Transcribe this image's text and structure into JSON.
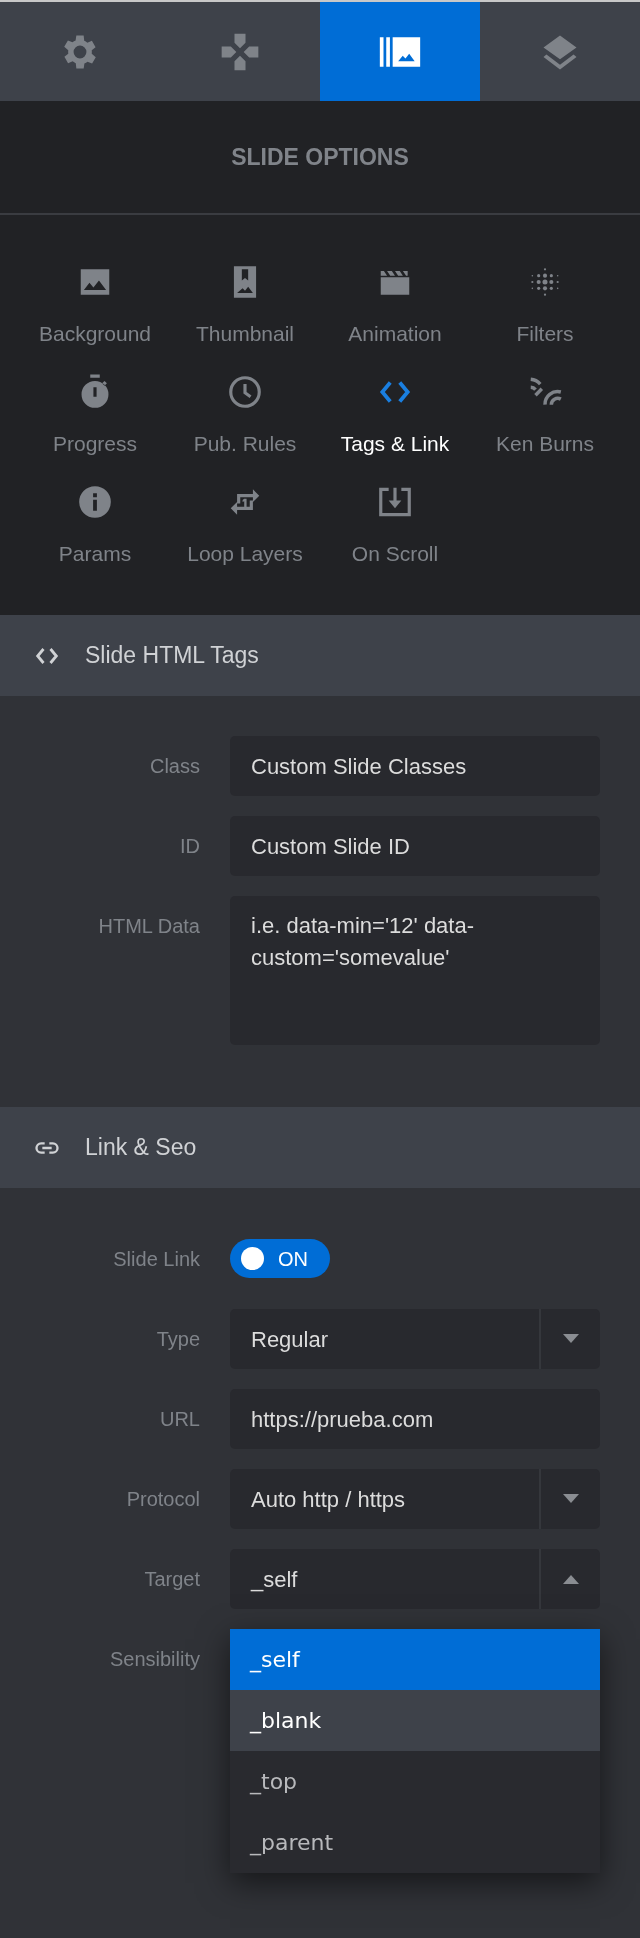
{
  "tabs": [
    {
      "kind": "gear",
      "selected": false
    },
    {
      "kind": "dpad",
      "selected": false
    },
    {
      "kind": "slides",
      "selected": true
    },
    {
      "kind": "layers",
      "selected": false
    }
  ],
  "panel_title": "SLIDE OPTIONS",
  "option_items": [
    {
      "label": "Background",
      "kind": "image",
      "selected": false
    },
    {
      "label": "Thumbnail",
      "kind": "bookmark",
      "selected": false
    },
    {
      "label": "Animation",
      "kind": "clapper",
      "selected": false
    },
    {
      "label": "Filters",
      "kind": "dots",
      "selected": false
    },
    {
      "label": "Progress",
      "kind": "timer",
      "selected": false
    },
    {
      "label": "Pub. Rules",
      "kind": "clock",
      "selected": false
    },
    {
      "label": "Tags & Link",
      "kind": "code",
      "selected": true
    },
    {
      "label": "Ken Burns",
      "kind": "waves",
      "selected": false
    },
    {
      "label": "Params",
      "kind": "info",
      "selected": false
    },
    {
      "label": "Loop Layers",
      "kind": "repeat",
      "selected": false
    },
    {
      "label": "On Scroll",
      "kind": "download",
      "selected": false
    }
  ],
  "sections": [
    {
      "title": "Slide HTML Tags",
      "kind": "code",
      "fields": [
        {
          "label": "Class",
          "kind": "text",
          "value": "Custom Slide Classes"
        },
        {
          "label": "ID",
          "kind": "text",
          "value": "Custom Slide ID"
        },
        {
          "label": "HTML Data",
          "kind": "textarea",
          "value": "i.e. data-min='12' data-custom='somevalue'"
        }
      ]
    },
    {
      "title": "Link & Seo",
      "kind": "link",
      "fields": [
        {
          "label": "Slide Link",
          "kind": "toggle",
          "on": true,
          "text": "ON"
        },
        {
          "label": "Type",
          "kind": "select",
          "value": "Regular",
          "expanded": false
        },
        {
          "label": "URL",
          "kind": "text",
          "value": "https://prueba.com"
        },
        {
          "label": "Protocol",
          "kind": "select",
          "value": "Auto http / https",
          "expanded": false
        },
        {
          "label": "Target",
          "kind": "select",
          "value": "_self",
          "expanded": true,
          "options": [
            {
              "label": "_self",
              "selected": true,
              "highlighted": false
            },
            {
              "label": "_blank",
              "selected": false,
              "highlighted": true
            },
            {
              "label": "_top",
              "selected": false,
              "highlighted": false
            },
            {
              "label": "_parent",
              "selected": false,
              "highlighted": false
            }
          ]
        },
        {
          "label": "Sensibility",
          "kind": "hidden"
        }
      ]
    }
  ]
}
